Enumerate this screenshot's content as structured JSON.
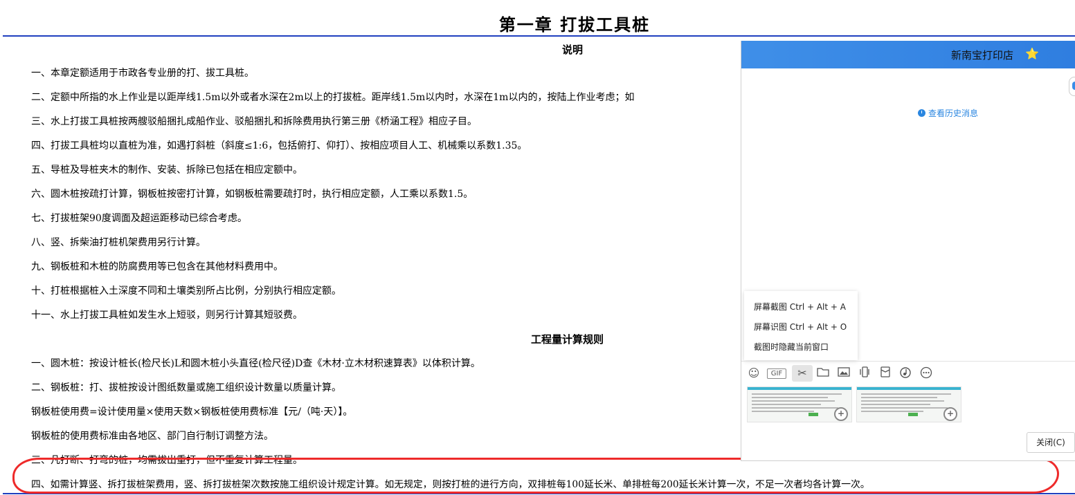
{
  "document": {
    "chapter_title": "第一章  打拔工具桩",
    "section1_title": "说明",
    "section1_lines": [
      "一、本章定额适用于市政各专业册的打、拔工具桩。",
      "二、定额中所指的水上作业是以距岸线1.5m以外或者水深在2m以上的打拔桩。距岸线1.5m以内时，水深在1m以内的，按陆上作业考虑；如",
      "三、水上打拔工具桩按两艘驳船捆扎成船作业、驳船捆扎和拆除费用执行第三册《桥涵工程》相应子目。",
      "四、打拔工具桩均以直桩为准，如遇打斜桩（斜度≤1:6，包括俯打、仰打）、按相应项目人工、机械乘以系数1.35。",
      "五、导桩及导桩夹木的制作、安装、拆除已包括在相应定额中。",
      "六、圆木桩按疏打计算，钢板桩按密打计算，如钢板桩需要疏打时，执行相应定额，人工乘以系数1.5。",
      "七、打拔桩架90度调面及超运距移动已综合考虑。",
      "八、竖、拆柴油打桩机架费用另行计算。",
      "九、钢板桩和木桩的防腐费用等已包含在其他材料费用中。",
      "十、打桩根据桩入土深度不同和土壤类别所占比例，分别执行相应定额。",
      "十一、水上打拔工具桩如发生水上短驳，则另行计算其短驳费。"
    ],
    "section2_title": "工程量计算规则",
    "section2_lines": [
      "一、圆木桩：按设计桩长(检尺长)L和圆木桩小头直径(检尺径)D查《木材·立木材积速算表》以体积计算。",
      "二、钢板桩：打、拔桩按设计图纸数量或施工组织设计数量以质量计算。",
      "钢板桩使用费=设计使用量×使用天数×钢板桩使用费标准【元/（吨·天）】。",
      "钢板桩的使用费标准由各地区、部门自行制订调整方法。",
      "三、凡打断、打弯的桩，均需拔出重打，但不重复计算工程量。",
      "四、如需计算竖、拆打拔桩架费用，竖、拆打拔桩架次数按施工组织设计规定计算。如无规定，则按打桩的进行方向，双排桩每100延长米、单排桩每200延长米计算一次，不足一次者均各计算一次。"
    ]
  },
  "chat": {
    "title": "新南宝打印店",
    "star_icon": "⭐",
    "history_link": "查看历史消息",
    "menu_items": [
      "屏幕截图 Ctrl + Alt + A",
      "屏幕识图 Ctrl + Alt + O",
      "截图时隐藏当前窗口"
    ],
    "toolbar_icons": [
      "emoji-icon",
      "gif-icon",
      "scissors-icon",
      "folder-icon",
      "image-icon",
      "vibrate-icon",
      "red-packet-icon",
      "music-icon",
      "more-icon"
    ],
    "gif_label": "GIF",
    "close_button": "关闭(C)",
    "colors": {
      "header": "#3f8fe8",
      "link": "#2a86e0",
      "highlight_oval": "#ee2a2a",
      "rule": "#1f3fbf"
    }
  }
}
